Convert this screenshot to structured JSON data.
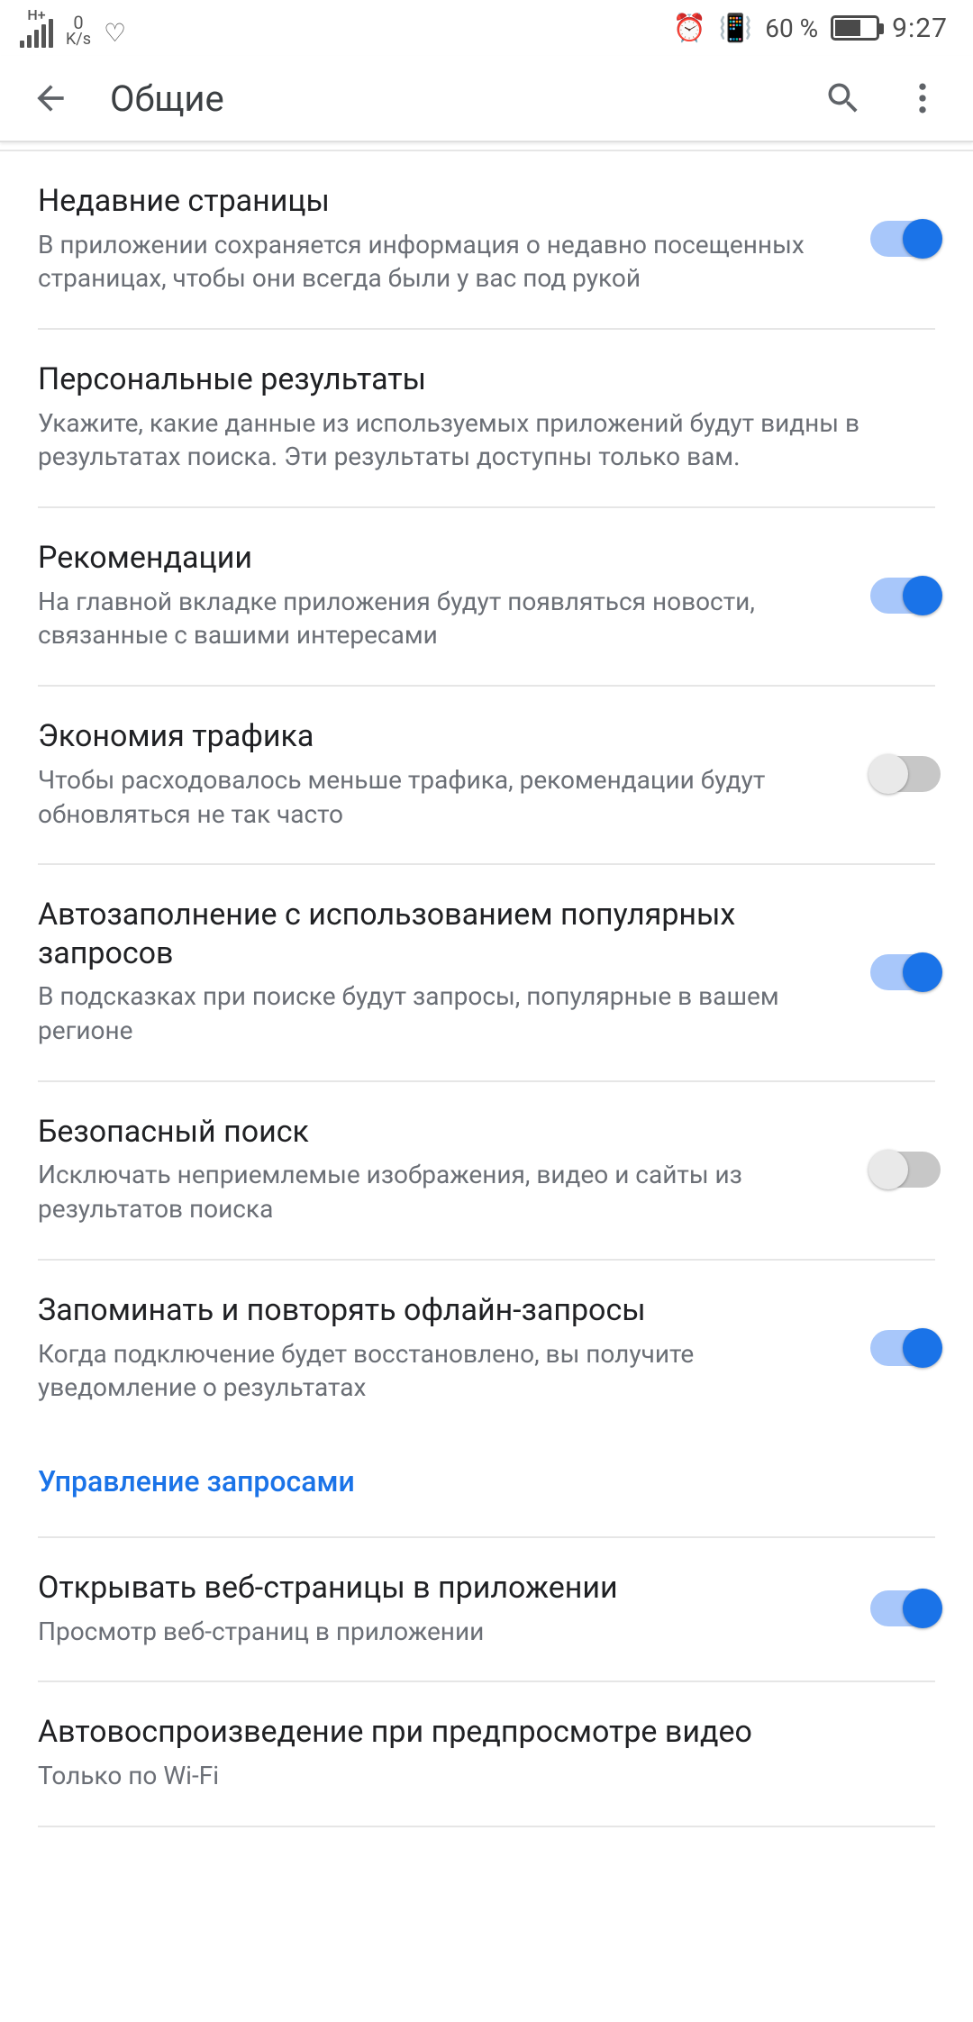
{
  "status": {
    "net_label_top": "H+",
    "rate_top": "0",
    "rate_bot": "K/s",
    "battery_pct": "60 %",
    "time": "9:27"
  },
  "appbar": {
    "title": "Общие"
  },
  "settings": [
    {
      "key": "recent-pages",
      "title": "Недавние страницы",
      "sub": "В приложении сохраняется информация о недавно посещенных страницах, чтобы они всегда были у вас под рукой",
      "toggle": true
    },
    {
      "key": "personal-results",
      "title": "Персональные результаты",
      "sub": "Укажите, какие данные из используемых приложений будут видны в результатах поиска. Эти результаты доступны только вам.",
      "toggle": null
    },
    {
      "key": "recommendations",
      "title": "Рекомендации",
      "sub": "На главной вкладке приложения будут появляться новости, связанные с вашими интересами",
      "toggle": true
    },
    {
      "key": "data-saver",
      "title": "Экономия трафика",
      "sub": "Чтобы расходовалось меньше трафика, рекомендации будут обновляться не так часто",
      "toggle": false
    },
    {
      "key": "autocomplete-trending",
      "title": "Автозаполнение с использованием популярных запросов",
      "sub": "В подсказках при поиске будут запросы, популярные в вашем регионе",
      "toggle": true
    },
    {
      "key": "safe-search",
      "title": "Безопасный поиск",
      "sub": "Исключать неприемлемые изображения, видео и сайты из результатов поиска",
      "toggle": false
    },
    {
      "key": "retry-offline",
      "title": "Запоминать и повторять офлайн-запросы",
      "sub": "Когда подключение будет восстановлено, вы получите уведомление о результатах",
      "toggle": true
    },
    {
      "key": "open-web-in-app",
      "title": "Открывать веб-страницы в приложении",
      "sub": "Просмотр веб-страниц в приложении",
      "toggle": true
    },
    {
      "key": "autoplay-preview",
      "title": "Автовоспроизведение при предпросмотре видео",
      "sub": "Только по Wi-Fi",
      "toggle": null
    }
  ],
  "link": {
    "label": "Управление запросами"
  },
  "colors": {
    "accent": "#1a73e8",
    "track_on": "#a8c7fa"
  }
}
